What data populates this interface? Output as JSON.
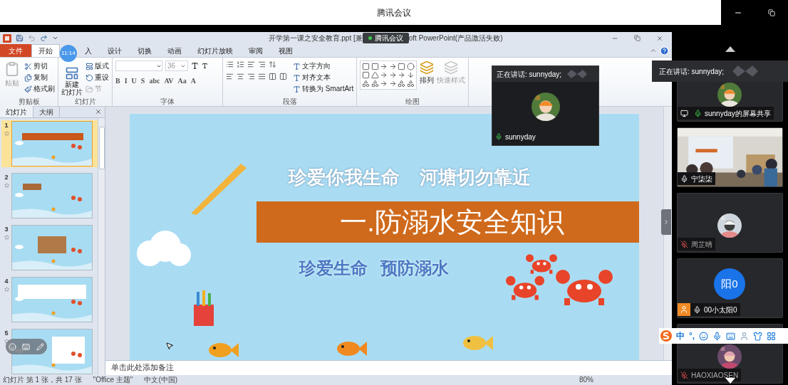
{
  "meeting": {
    "title": "腾讯会议"
  },
  "ppt": {
    "title_parts": [
      {
        "text": "开学第一课之安全教育.ppt [兼",
        "kind": "plain"
      },
      {
        "text": "腾讯会议",
        "kind": "overlay"
      },
      {
        "text": "oft PowerPoint(产品激活失败)",
        "kind": "plain"
      }
    ],
    "tabs": [
      {
        "label": "文件",
        "kind": "file",
        "selected": false
      },
      {
        "label": "开始",
        "kind": "tab",
        "selected": true
      },
      {
        "label": "入",
        "kind": "tab",
        "selected": false
      },
      {
        "label": "设计",
        "kind": "tab",
        "selected": false
      },
      {
        "label": "切换",
        "kind": "tab",
        "selected": false
      },
      {
        "label": "动画",
        "kind": "tab",
        "selected": false
      },
      {
        "label": "幻灯片放映",
        "kind": "tab",
        "selected": false
      },
      {
        "label": "审阅",
        "kind": "tab",
        "selected": false
      },
      {
        "label": "视图",
        "kind": "tab",
        "selected": false
      }
    ],
    "time_badge": "11:14",
    "ribbon": [
      {
        "label": "剪贴板",
        "kind": "clipboard",
        "items": [
          {
            "label": "粘贴",
            "disabled": true
          },
          {
            "label": "剪切",
            "disabled": false
          },
          {
            "label": "复制",
            "disabled": false
          },
          {
            "label": "格式刷",
            "disabled": false
          }
        ]
      },
      {
        "label": "幻灯片",
        "kind": "slides",
        "items": [
          {
            "lines": [
              "新建",
              "幻灯片"
            ],
            "disabled": false
          },
          {
            "label": "版式",
            "disabled": false
          },
          {
            "label": "重设",
            "disabled": false
          },
          {
            "label": "节",
            "disabled": true
          }
        ]
      },
      {
        "label": "字体",
        "kind": "font",
        "size": "36",
        "glyphs": [
          "B",
          "I",
          "U",
          "S",
          "abc",
          "AV",
          "Aa",
          "A"
        ]
      },
      {
        "label": "段落",
        "kind": "paragraph",
        "items": [
          {
            "label": "文字方向",
            "disabled": false
          },
          {
            "label": "对齐文本",
            "disabled": false
          },
          {
            "label": "转换为 SmartArt",
            "disabled": false
          }
        ]
      },
      {
        "label": "绘图",
        "kind": "drawing",
        "items": [
          {
            "label": "排列",
            "disabled": false
          },
          {
            "label": "快速样式",
            "disabled": true
          }
        ]
      }
    ],
    "pane_tabs": [
      {
        "label": "幻灯片",
        "selected": true
      },
      {
        "label": "大纲",
        "selected": false
      }
    ],
    "thumbnails": [
      {
        "number": "1",
        "selected": true
      },
      {
        "number": "2",
        "selected": false
      },
      {
        "number": "3",
        "selected": false
      },
      {
        "number": "4",
        "selected": false
      },
      {
        "number": "5",
        "selected": false
      }
    ],
    "slide": {
      "headline": [
        "珍爱你我生命",
        "河塘切勿靠近"
      ],
      "banner": "一.防溺水安全知识",
      "subtitle": [
        "珍爱生命",
        "预防溺水"
      ]
    },
    "notes_placeholder": "单击此处添加备注",
    "status_bar": [
      "幻灯片 第 1 张，共 17 张",
      "\"Office 主题\"",
      "中文(中国)",
      "80%"
    ]
  },
  "speaker_popup": {
    "caption": "正在讲话: sunnyday;",
    "name": "sunnyday",
    "speaking": true
  },
  "speaking_banner": {
    "caption": "正在讲话: sunnyday;"
  },
  "participants": [
    {
      "name": "sunnyday的屏幕共享",
      "kind": "avatar",
      "sharing": true,
      "speaking": true,
      "muted": false,
      "self": false
    },
    {
      "name": "宁柒柒",
      "kind": "video",
      "sharing": false,
      "speaking": false,
      "muted": false,
      "self": false
    },
    {
      "name": "周芷晴",
      "kind": "avatar",
      "sharing": false,
      "speaking": false,
      "muted": true,
      "self": false
    },
    {
      "name": "00小太阳0",
      "kind": "initials",
      "initials": "阳0",
      "sharing": false,
      "speaking": false,
      "muted": false,
      "self": true
    },
    {
      "name": "HAOXIAOSEN",
      "kind": "avatar",
      "sharing": false,
      "speaking": false,
      "muted": true,
      "self": false
    }
  ],
  "ime_toolbar": [
    "中",
    "°,"
  ]
}
